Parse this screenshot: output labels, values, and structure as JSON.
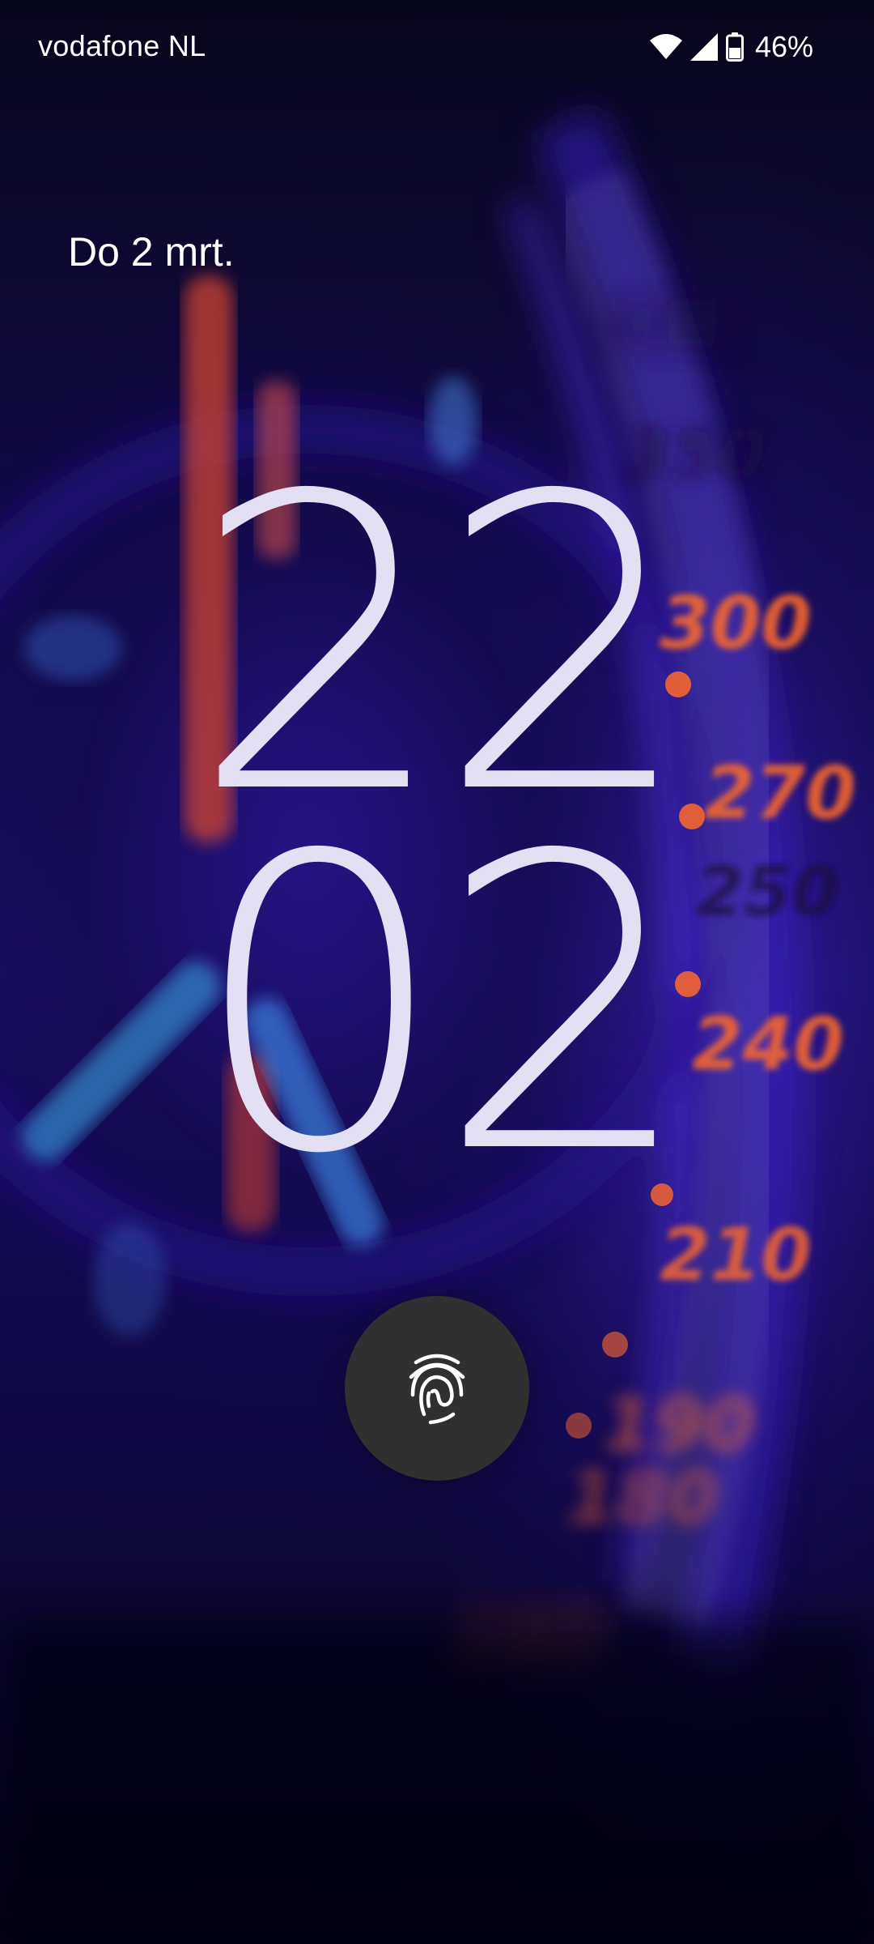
{
  "status_bar": {
    "carrier": "vodafone NL",
    "battery_percent": "46%",
    "icons": [
      "wifi-icon",
      "cell-signal-icon",
      "battery-icon"
    ]
  },
  "lockscreen": {
    "date": "Do 2 mrt.",
    "clock_hours": "22",
    "clock_minutes": "02",
    "unlock_icon": "fingerprint-icon"
  },
  "colors": {
    "clock": "#e4e0f4",
    "fingerprint_bg": "#303030",
    "accent_orange": "#ff6a2a",
    "wallpaper_blue": "#1a0f63"
  }
}
